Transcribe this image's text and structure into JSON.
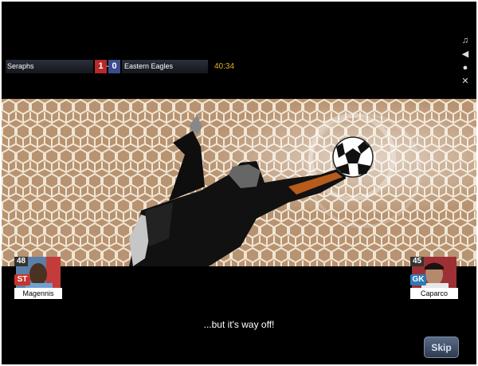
{
  "match": {
    "home_team": "Seraphs",
    "home_score": "1",
    "separator": "-",
    "away_score": "0",
    "away_team": "Eastern Eagles",
    "clock": "40:34"
  },
  "controls": {
    "music": "♫",
    "sound": "◀",
    "quality": "●",
    "fullscreen": "✕"
  },
  "players": {
    "left": {
      "rating": "48",
      "position": "ST",
      "name": "Magennis",
      "position_color": "#c8342a"
    },
    "right": {
      "rating": "45",
      "position": "GK",
      "name": "Caparco",
      "position_color": "#2d7ab8"
    }
  },
  "commentary": "...but it's way off!",
  "skip_label": "Skip"
}
